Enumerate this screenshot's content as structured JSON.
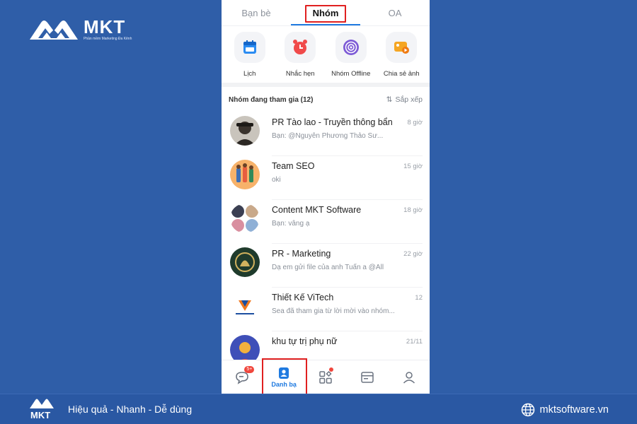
{
  "brand": {
    "name": "MKT",
    "tagline": "Phần mềm Marketing Đa Kênh"
  },
  "tabs": [
    {
      "label": "Bạn bè",
      "active": false
    },
    {
      "label": "Nhóm",
      "active": true
    },
    {
      "label": "OA",
      "active": false
    }
  ],
  "shortcuts": [
    {
      "label": "Lịch",
      "icon": "calendar-icon"
    },
    {
      "label": "Nhắc hẹn",
      "icon": "alarm-clock-icon"
    },
    {
      "label": "Nhóm Offline",
      "icon": "radar-icon"
    },
    {
      "label": "Chia sẻ ảnh",
      "icon": "photo-share-icon"
    }
  ],
  "section": {
    "title": "Nhóm đang tham gia (12)",
    "sort_label": "Sắp xếp"
  },
  "groups": [
    {
      "title": "PR Tào lao - Truyền thông bẩn",
      "subtitle": "Bạn: @Nguyễn Phương Thảo Sư...",
      "time": "8 giờ"
    },
    {
      "title": "Team SEO",
      "subtitle": "oki",
      "time": "15 giờ"
    },
    {
      "title": "Content MKT Software",
      "subtitle": "Bạn: vâng ạ",
      "time": "18 giờ"
    },
    {
      "title": "PR - Marketing",
      "subtitle": "Dạ em gửi file của anh Tuấn a @All",
      "time": "22 giờ"
    },
    {
      "title": "Thiết Kế ViTech",
      "subtitle": "Sea đã tham gia từ lời mời vào nhóm...",
      "time": "12"
    },
    {
      "title": "khu tự trị phụ nữ",
      "subtitle": "",
      "time": "21/11"
    }
  ],
  "bottom_nav": {
    "messages_badge": "5+",
    "contacts_label": "Danh bạ"
  },
  "footer": {
    "slogan": "Hiệu quả - Nhanh - Dễ dùng",
    "website": "mktsoftware.vn"
  },
  "colors": {
    "background": "#2f5ea8",
    "accent": "#1f7ae0",
    "highlight": "#e02020"
  }
}
